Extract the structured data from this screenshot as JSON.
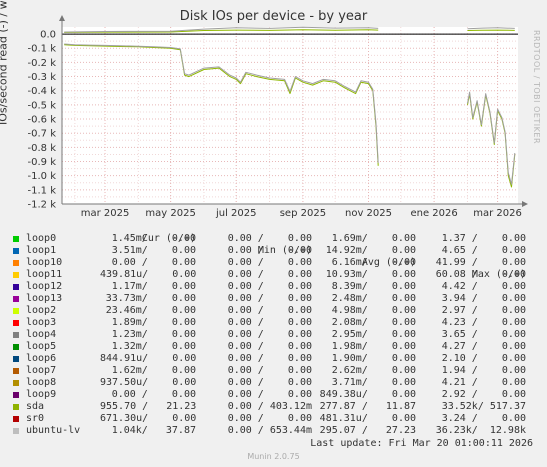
{
  "title": "Disk IOs per device - by year",
  "watermark": "RRDTOOL / TOBI OETIKER",
  "chart_data": {
    "type": "line",
    "title": "Disk IOs per device - by year",
    "ylabel": "IOs/second read (-) / write (+)",
    "ylim": [
      -1200,
      50
    ],
    "yticks": [
      {
        "label": "0.0",
        "value": 0
      },
      {
        "label": "-0.1 k",
        "value": -100
      },
      {
        "label": "-0.2 k",
        "value": -200
      },
      {
        "label": "-0.3 k",
        "value": -300
      },
      {
        "label": "-0.4 k",
        "value": -400
      },
      {
        "label": "-0.5 k",
        "value": -500
      },
      {
        "label": "-0.6 k",
        "value": -600
      },
      {
        "label": "-0.7 k",
        "value": -700
      },
      {
        "label": "-0.8 k",
        "value": -800
      },
      {
        "label": "-0.9 k",
        "value": -900
      },
      {
        "label": "-1.0 k",
        "value": -1000
      },
      {
        "label": "-1.1 k",
        "value": -1100
      },
      {
        "label": "-1.2 k",
        "value": -1200
      }
    ],
    "xlim": [
      "2025-01-20",
      "2026-03-20"
    ],
    "xticks": [
      {
        "label": "mar 2025",
        "date": "2025-03-01"
      },
      {
        "label": "may 2025",
        "date": "2025-05-01"
      },
      {
        "label": "jul 2025",
        "date": "2025-07-01"
      },
      {
        "label": "sep 2025",
        "date": "2025-09-01"
      },
      {
        "label": "nov 2025",
        "date": "2025-11-01"
      },
      {
        "label": "ene 2026",
        "date": "2026-01-01"
      },
      {
        "label": "mar 2026",
        "date": "2026-03-01"
      }
    ],
    "grid": true,
    "series": [
      {
        "name": "sda",
        "color": "#8fb800",
        "segments": [
          [
            [
              "2025-01-22",
              -75
            ],
            [
              "2025-02-01",
              -80
            ],
            [
              "2025-02-15",
              -82
            ],
            [
              "2025-03-01",
              -85
            ],
            [
              "2025-03-15",
              -88
            ],
            [
              "2025-04-01",
              -90
            ],
            [
              "2025-04-15",
              -95
            ],
            [
              "2025-05-01",
              -100
            ],
            [
              "2025-05-10",
              -110
            ],
            [
              "2025-05-14",
              -290
            ],
            [
              "2025-05-18",
              -300
            ],
            [
              "2025-06-01",
              -250
            ],
            [
              "2025-06-15",
              -240
            ],
            [
              "2025-06-25",
              -300
            ],
            [
              "2025-07-01",
              -320
            ],
            [
              "2025-07-05",
              -350
            ],
            [
              "2025-07-10",
              -280
            ],
            [
              "2025-07-20",
              -300
            ],
            [
              "2025-08-01",
              -320
            ],
            [
              "2025-08-15",
              -330
            ],
            [
              "2025-08-20",
              -420
            ],
            [
              "2025-08-25",
              -310
            ],
            [
              "2025-09-01",
              -340
            ],
            [
              "2025-09-10",
              -360
            ],
            [
              "2025-09-20",
              -330
            ],
            [
              "2025-10-01",
              -340
            ],
            [
              "2025-10-10",
              -380
            ],
            [
              "2025-10-20",
              -420
            ],
            [
              "2025-10-25",
              -340
            ],
            [
              "2025-11-01",
              -350
            ],
            [
              "2025-11-05",
              -400
            ],
            [
              "2025-11-08",
              -650
            ],
            [
              "2025-11-10",
              -930
            ]
          ],
          [
            [
              "2026-02-01",
              -500
            ],
            [
              "2026-02-03",
              -420
            ],
            [
              "2026-02-06",
              -600
            ],
            [
              "2026-02-10",
              -480
            ],
            [
              "2026-02-14",
              -650
            ],
            [
              "2026-02-18",
              -430
            ],
            [
              "2026-02-22",
              -560
            ],
            [
              "2026-02-26",
              -780
            ],
            [
              "2026-03-01",
              -540
            ],
            [
              "2026-03-05",
              -600
            ],
            [
              "2026-03-08",
              -700
            ],
            [
              "2026-03-11",
              -1000
            ],
            [
              "2026-03-14",
              -1080
            ],
            [
              "2026-03-17",
              -850
            ]
          ]
        ]
      },
      {
        "name": "ubuntu-lv",
        "color": "#a0a0a0",
        "segments": [
          [
            [
              "2025-01-22",
              -70
            ],
            [
              "2025-02-01",
              -75
            ],
            [
              "2025-02-15",
              -78
            ],
            [
              "2025-03-01",
              -80
            ],
            [
              "2025-03-15",
              -82
            ],
            [
              "2025-04-01",
              -86
            ],
            [
              "2025-04-15",
              -90
            ],
            [
              "2025-05-01",
              -95
            ],
            [
              "2025-05-10",
              -105
            ],
            [
              "2025-05-14",
              -280
            ],
            [
              "2025-05-18",
              -290
            ],
            [
              "2025-06-01",
              -240
            ],
            [
              "2025-06-15",
              -232
            ],
            [
              "2025-06-25",
              -290
            ],
            [
              "2025-07-01",
              -310
            ],
            [
              "2025-07-05",
              -340
            ],
            [
              "2025-07-10",
              -270
            ],
            [
              "2025-07-20",
              -290
            ],
            [
              "2025-08-01",
              -310
            ],
            [
              "2025-08-15",
              -320
            ],
            [
              "2025-08-20",
              -405
            ],
            [
              "2025-08-25",
              -300
            ],
            [
              "2025-09-01",
              -330
            ],
            [
              "2025-09-10",
              -350
            ],
            [
              "2025-09-20",
              -320
            ],
            [
              "2025-10-01",
              -330
            ],
            [
              "2025-10-10",
              -370
            ],
            [
              "2025-10-20",
              -410
            ],
            [
              "2025-10-25",
              -330
            ],
            [
              "2025-11-01",
              -340
            ],
            [
              "2025-11-05",
              -390
            ],
            [
              "2025-11-08",
              -630
            ],
            [
              "2025-11-10",
              -910
            ]
          ],
          [
            [
              "2026-02-01",
              -490
            ],
            [
              "2026-02-03",
              -410
            ],
            [
              "2026-02-06",
              -590
            ],
            [
              "2026-02-10",
              -470
            ],
            [
              "2026-02-14",
              -640
            ],
            [
              "2026-02-18",
              -420
            ],
            [
              "2026-02-22",
              -550
            ],
            [
              "2026-02-26",
              -770
            ],
            [
              "2026-03-01",
              -530
            ],
            [
              "2026-03-05",
              -590
            ],
            [
              "2026-03-08",
              -690
            ],
            [
              "2026-03-11",
              -980
            ],
            [
              "2026-03-14",
              -1060
            ],
            [
              "2026-03-17",
              -840
            ]
          ]
        ]
      },
      {
        "name": "sda (write)",
        "color": "#8fb800",
        "segments": [
          [
            [
              "2025-01-22",
              12
            ],
            [
              "2025-03-01",
              14
            ],
            [
              "2025-05-01",
              15
            ],
            [
              "2025-06-01",
              25
            ],
            [
              "2025-07-01",
              28
            ],
            [
              "2025-08-01",
              26
            ],
            [
              "2025-09-01",
              30
            ],
            [
              "2025-10-01",
              27
            ],
            [
              "2025-11-01",
              30
            ],
            [
              "2025-11-10",
              28
            ]
          ],
          [
            [
              "2026-02-01",
              25
            ],
            [
              "2026-02-15",
              27
            ],
            [
              "2026-03-01",
              28
            ],
            [
              "2026-03-17",
              26
            ]
          ]
        ]
      },
      {
        "name": "ubuntu-lv (write)",
        "color": "#a0a0a0",
        "segments": [
          [
            [
              "2025-01-22",
              15
            ],
            [
              "2025-03-01",
              18
            ],
            [
              "2025-05-01",
              20
            ],
            [
              "2025-06-01",
              35
            ],
            [
              "2025-07-01",
              45
            ],
            [
              "2025-08-01",
              40
            ],
            [
              "2025-09-01",
              48
            ],
            [
              "2025-10-01",
              42
            ],
            [
              "2025-11-01",
              45
            ],
            [
              "2025-11-10",
              40
            ]
          ],
          [
            [
              "2026-02-01",
              38
            ],
            [
              "2026-02-15",
              42
            ],
            [
              "2026-03-01",
              44
            ],
            [
              "2026-03-17",
              40
            ]
          ]
        ]
      }
    ]
  },
  "legend": {
    "headers": {
      "cur": "Cur (-/+)",
      "min": "Min (-/+)",
      "avg": "Avg (-/+)",
      "max": "Max (-/+)"
    },
    "rows": [
      {
        "name": "loop0",
        "color": "#00cc00",
        "cur": "1.45m/    0.00",
        "min": "0.00 /    0.00",
        "avg": "1.69m/    0.00",
        "max": "1.37 /    0.00"
      },
      {
        "name": "loop1",
        "color": "#0066b3",
        "cur": "3.51m/    0.00",
        "min": "0.00 /    0.00",
        "avg": "14.92m/    0.00",
        "max": "4.65 /    0.00"
      },
      {
        "name": "loop10",
        "color": "#ff8000",
        "cur": "0.00 /    0.00",
        "min": "0.00 /    0.00",
        "avg": "6.16m/    0.00",
        "max": "41.99 /    0.00"
      },
      {
        "name": "loop11",
        "color": "#ffcc00",
        "cur": "439.81u/    0.00",
        "min": "0.00 /    0.00",
        "avg": "10.93m/    0.00",
        "max": "60.08 /    0.00"
      },
      {
        "name": "loop12",
        "color": "#330099",
        "cur": "1.17m/    0.00",
        "min": "0.00 /    0.00",
        "avg": "8.39m/    0.00",
        "max": "4.42 /    0.00"
      },
      {
        "name": "loop13",
        "color": "#990099",
        "cur": "33.73m/    0.00",
        "min": "0.00 /    0.00",
        "avg": "2.48m/    0.00",
        "max": "3.94 /    0.00"
      },
      {
        "name": "loop2",
        "color": "#ccff00",
        "cur": "23.46m/    0.00",
        "min": "0.00 /    0.00",
        "avg": "4.98m/    0.00",
        "max": "2.97 /    0.00"
      },
      {
        "name": "loop3",
        "color": "#ff0000",
        "cur": "1.89m/    0.00",
        "min": "0.00 /    0.00",
        "avg": "2.08m/    0.00",
        "max": "4.23 /    0.00"
      },
      {
        "name": "loop4",
        "color": "#808080",
        "cur": "1.23m/    0.00",
        "min": "0.00 /    0.00",
        "avg": "2.95m/    0.00",
        "max": "3.65 /    0.00"
      },
      {
        "name": "loop5",
        "color": "#008f00",
        "cur": "1.32m/    0.00",
        "min": "0.00 /    0.00",
        "avg": "1.98m/    0.00",
        "max": "4.27 /    0.00"
      },
      {
        "name": "loop6",
        "color": "#00487d",
        "cur": "844.91u/    0.00",
        "min": "0.00 /    0.00",
        "avg": "1.90m/    0.00",
        "max": "2.10 /    0.00"
      },
      {
        "name": "loop7",
        "color": "#b35a00",
        "cur": "1.62m/    0.00",
        "min": "0.00 /    0.00",
        "avg": "2.62m/    0.00",
        "max": "1.94 /    0.00"
      },
      {
        "name": "loop8",
        "color": "#b38f00",
        "cur": "937.50u/    0.00",
        "min": "0.00 /    0.00",
        "avg": "3.71m/    0.00",
        "max": "4.21 /    0.00"
      },
      {
        "name": "loop9",
        "color": "#6b006b",
        "cur": "0.00 /    0.00",
        "min": "0.00 /    0.00",
        "avg": "849.38u/    0.00",
        "max": "2.92 /    0.00"
      },
      {
        "name": "sda",
        "color": "#8fb300",
        "cur": "955.70 /   21.23",
        "min": "0.00 / 403.12m",
        "avg": "277.87 /   11.87",
        "max": "33.52k/ 517.37"
      },
      {
        "name": "sr0",
        "color": "#b30000",
        "cur": "671.30u/    0.00",
        "min": "0.00 /    0.00",
        "avg": "481.31u/    0.00",
        "max": "3.24 /    0.00"
      },
      {
        "name": "ubuntu-lv",
        "color": "#bebebe",
        "cur": "1.04k/   37.87",
        "min": "0.00 / 653.44m",
        "avg": "295.07 /   27.23",
        "max": "36.23k/  12.98k"
      }
    ]
  },
  "last_update": "Last update: Fri Mar 20 01:00:11 2026",
  "footer": "Munin 2.0.75"
}
